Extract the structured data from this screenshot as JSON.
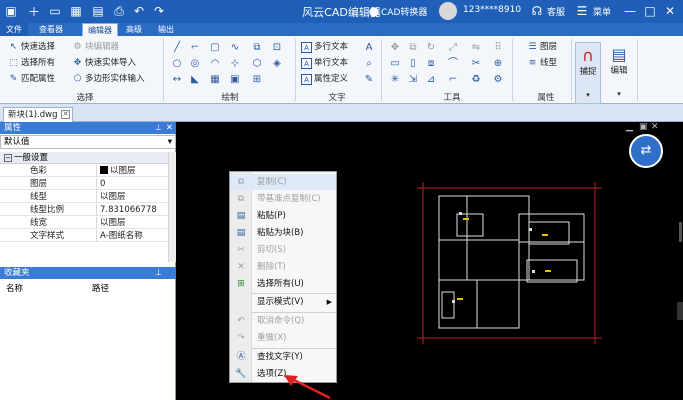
{
  "title": "风云CAD编辑器",
  "titlebar": {
    "cad_converter": "CAD转换器",
    "account": "123****8910",
    "service": "客服",
    "menu": "菜单"
  },
  "menu_tabs": [
    "文件",
    "查看器",
    "编辑器",
    "高级",
    "输出"
  ],
  "ribbon": {
    "select_group": {
      "items": [
        "快速选择",
        "选择所有",
        "匹配属性",
        "块编辑器",
        "快速实体导入",
        "多边形实体输入"
      ],
      "label": "选择"
    },
    "draw_group": {
      "label": "绘制"
    },
    "text_group": {
      "items": [
        "多行文本",
        "单行文本",
        "属性定义"
      ],
      "label": "文字"
    },
    "tools_group": {
      "label": "工具"
    },
    "props_group": {
      "items": [
        "图层",
        "线型"
      ],
      "label": "属性"
    },
    "capture": "捕捉",
    "edit": "编辑"
  },
  "doc_tab": "新块(1).dwg",
  "properties_panel": {
    "title": "属性",
    "dropdown": "默认值",
    "section": "一般设置",
    "rows": [
      {
        "k": "色彩",
        "v": "以图层"
      },
      {
        "k": "图层",
        "v": "0"
      },
      {
        "k": "线型",
        "v": "以图层"
      },
      {
        "k": "线型比例",
        "v": "7.831066778"
      },
      {
        "k": "线宽",
        "v": "以图层"
      },
      {
        "k": "文字样式",
        "v": "A-图纸名称"
      }
    ]
  },
  "favorites_panel": {
    "title": "收藏夹",
    "col_name": "名称",
    "col_path": "路径"
  },
  "context_menu": [
    {
      "label": "复制(C)",
      "disabled": true
    },
    {
      "label": "带基准点复制(C)",
      "disabled": true
    },
    {
      "label": "粘贴(P)",
      "disabled": false
    },
    {
      "label": "粘贴为块(B)",
      "disabled": false
    },
    {
      "label": "剪切(S)",
      "disabled": true
    },
    {
      "label": "删除(T)",
      "disabled": true
    },
    {
      "label": "选择所有(U)",
      "disabled": false
    },
    {
      "label": "显示模式(V)",
      "disabled": false
    },
    {
      "label": "取消命令(Q)",
      "disabled": true
    },
    {
      "label": "重做(X)",
      "disabled": true
    },
    {
      "label": "查找文字(Y)",
      "disabled": false
    },
    {
      "label": "选项(Z)",
      "disabled": false
    }
  ],
  "colors": {
    "titlebar": "#1f5fb8",
    "accent": "#3a7bd5",
    "arrow": "#e02020"
  }
}
